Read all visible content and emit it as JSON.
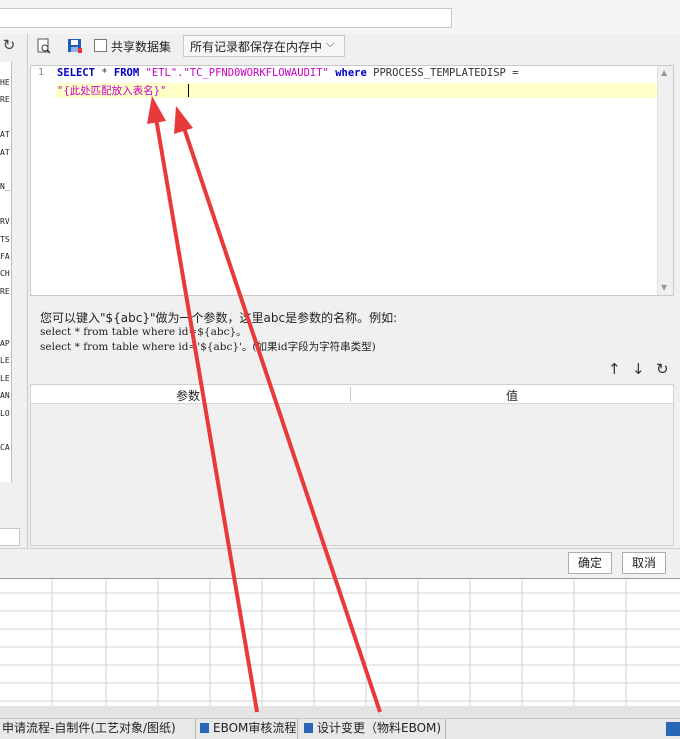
{
  "toolbar": {
    "share_label": "共享数据集",
    "storage_select": "所有记录都保存在内存中"
  },
  "editor": {
    "line_number": "1",
    "line1": {
      "kw_select": "SELECT",
      "star": " * ",
      "kw_from": "FROM",
      "schema": "\"ETL\".\"TC_PFND0WORKFLOWAUDIT\"",
      "kw_where": "where",
      "condition": " PPROCESS_TEMPLATEDISP ="
    },
    "line2": "\"{此处匹配放入表名}\""
  },
  "hint": {
    "line1": "您可以键入\"${abc}\"做为一个参数，这里abc是参数的名称。例如:",
    "line2": "select * from table where id=${abc}。",
    "line3": "select * from table where id='${abc}'。(如果id字段为字符串类型)"
  },
  "param_table": {
    "col_param": "参数",
    "col_value": "值"
  },
  "buttons": {
    "ok": "确定",
    "cancel": "取消"
  },
  "left_list": [
    "HE",
    "RE",
    "",
    "AT",
    "AT",
    "",
    "N_",
    "",
    "RV",
    "TS",
    "FA",
    "CH",
    "RE",
    "",
    "",
    "AP",
    "LE",
    "LE",
    "AN",
    "LO",
    "",
    "CA"
  ],
  "tabs": [
    {
      "label": "申请流程-自制件(工艺对象/图纸)"
    },
    {
      "label": "EBOM审核流程"
    },
    {
      "label": "设计变更（物料EBOM)"
    }
  ],
  "colors": {
    "keyword": "#0000c8",
    "string": "#c800c8",
    "highlight": "#ffffc8",
    "arrow": "#e83a3a"
  }
}
